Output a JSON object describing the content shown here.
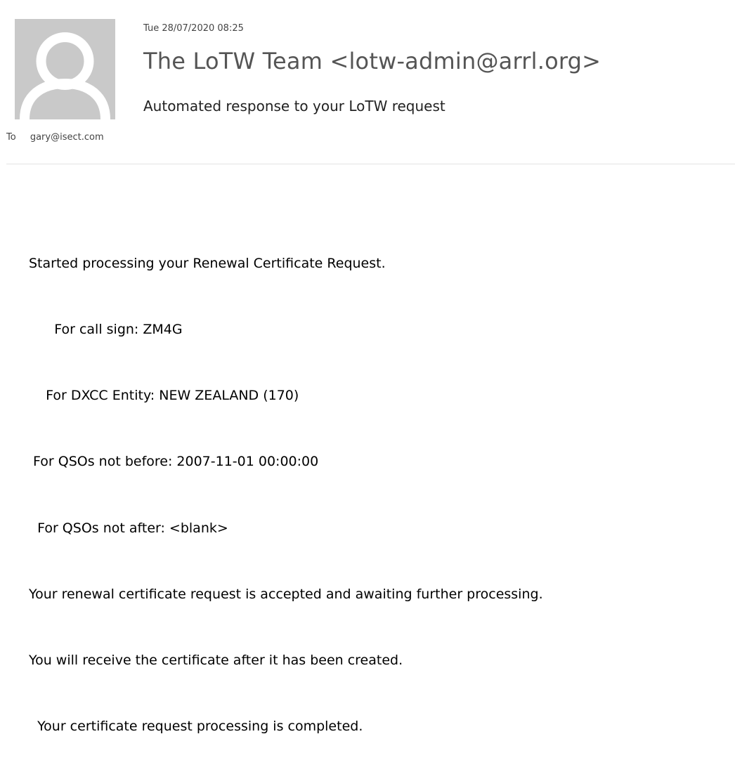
{
  "email": {
    "date": "Tue 28/07/2020 08:25",
    "sender": "The LoTW Team <lotw-admin@arrl.org>",
    "subject": "Automated response to your LoTW request",
    "to_label": "To",
    "to_address": "gary@isect.com",
    "avatar_icon": "person-silhouette-icon",
    "body_lines": [
      "Started processing your Renewal Certificate Request.",
      "      For call sign: ZM4G",
      "    For DXCC Entity: NEW ZEALAND (170)",
      " For QSOs not before: 2007-11-01 00:00:00",
      "  For QSOs not after: <blank>",
      "Your renewal certificate request is accepted and awaiting further processing.",
      "You will receive the certificate after it has been created.",
      "  Your certificate request processing is completed."
    ]
  },
  "colors": {
    "avatar_bg": "#c9c9c9",
    "avatar_fg": "#ffffff"
  }
}
